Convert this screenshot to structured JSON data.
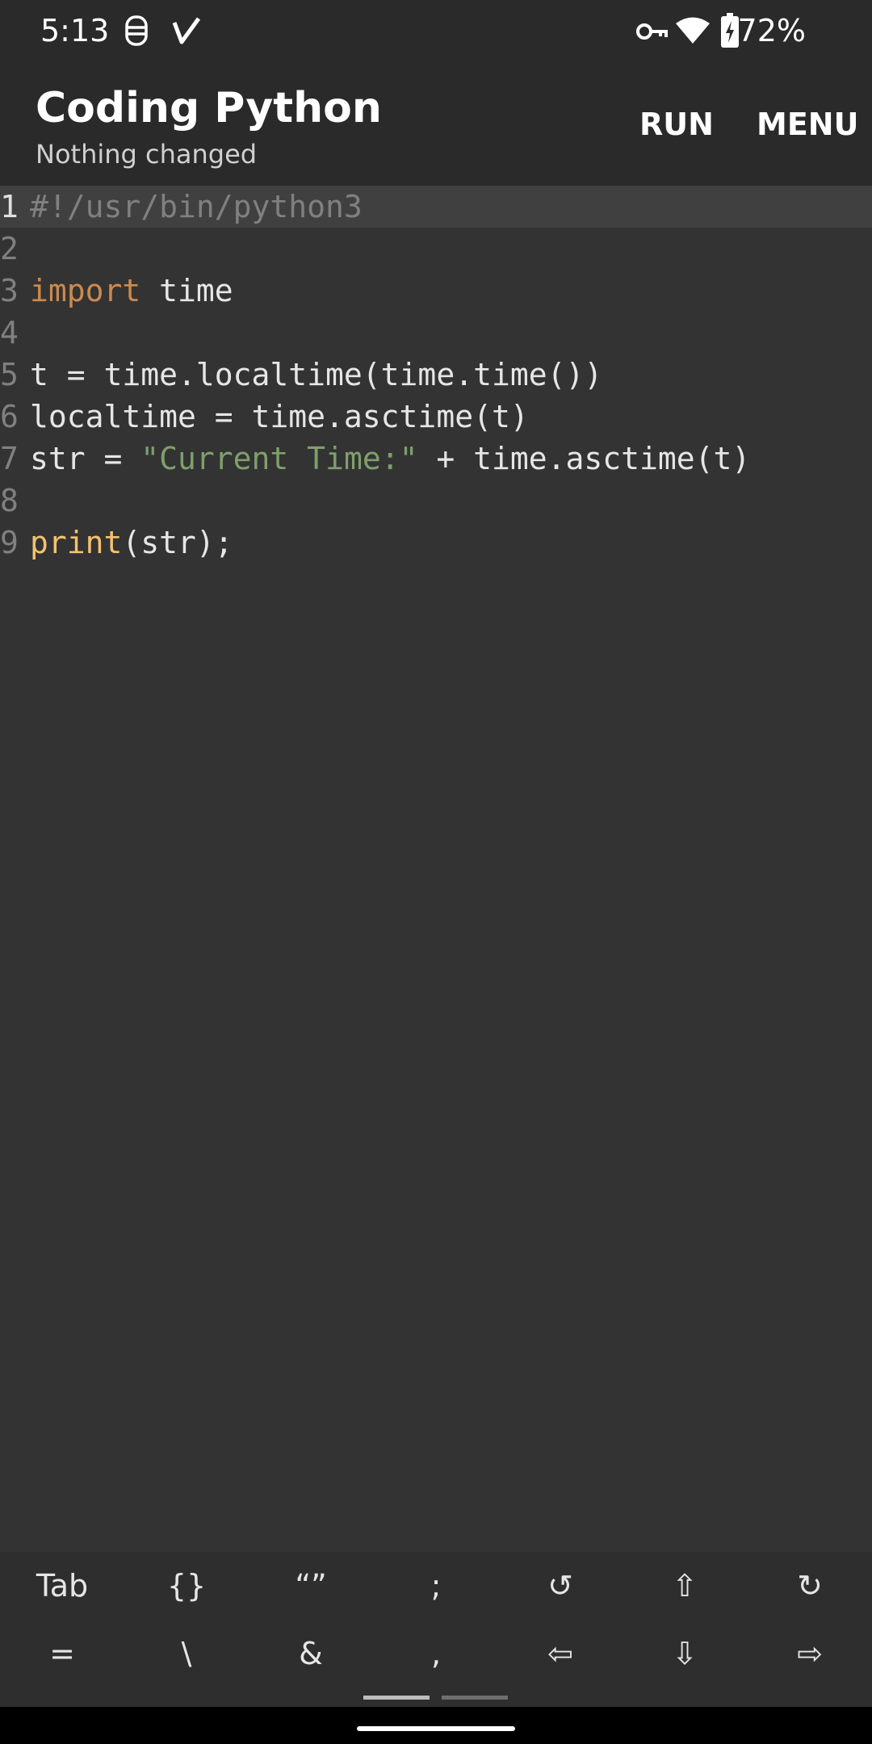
{
  "status_bar": {
    "time": "5:13",
    "battery_percent": "72%",
    "icons": [
      "notification-icon",
      "check-icon",
      "vpn-key-icon",
      "wifi-icon",
      "battery-charging-icon"
    ]
  },
  "app_bar": {
    "title": "Coding Python",
    "subtitle": "Nothing changed",
    "run_label": "RUN",
    "menu_label": "MENU"
  },
  "editor": {
    "current_line": 1,
    "lines": [
      {
        "number": "1",
        "tokens": [
          {
            "type": "comment",
            "text": "#!/usr/bin/python3"
          }
        ]
      },
      {
        "number": "2",
        "tokens": []
      },
      {
        "number": "3",
        "tokens": [
          {
            "type": "keyword",
            "text": "import"
          },
          {
            "type": "plain",
            "text": " time"
          }
        ]
      },
      {
        "number": "4",
        "tokens": []
      },
      {
        "number": "5",
        "tokens": [
          {
            "type": "plain",
            "text": "t = time.localtime(time.time())"
          }
        ]
      },
      {
        "number": "6",
        "tokens": [
          {
            "type": "plain",
            "text": "localtime = time.asctime(t)"
          }
        ]
      },
      {
        "number": "7",
        "tokens": [
          {
            "type": "plain",
            "text": "str = "
          },
          {
            "type": "string",
            "text": "\"Current Time:\""
          },
          {
            "type": "plain",
            "text": " + time.asctime(t)"
          }
        ]
      },
      {
        "number": "8",
        "tokens": []
      },
      {
        "number": "9",
        "tokens": [
          {
            "type": "func",
            "text": "print"
          },
          {
            "type": "plain",
            "text": "(str);"
          }
        ]
      }
    ]
  },
  "symbol_bar": {
    "row1": [
      "Tab",
      "{}",
      "“”",
      ";",
      "↺",
      "⇧",
      "↻"
    ],
    "row2": [
      "=",
      "\\",
      "&",
      ",",
      "⇦",
      "⇩",
      "⇨"
    ]
  },
  "colors": {
    "background": "#333333",
    "app_bar": "#2a2a2a",
    "keyword": "#cc8a4e",
    "function": "#f3c26e",
    "string": "#7f9f6d",
    "comment": "#808080"
  }
}
